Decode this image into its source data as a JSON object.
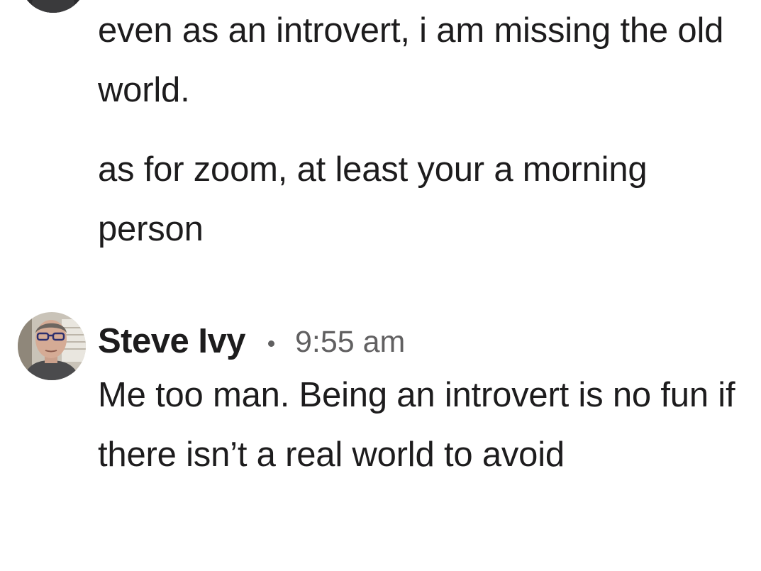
{
  "messages": [
    {
      "paragraphs": [
        "even as an introvert, i am missing the old world.",
        "as for zoom, at least your a morning person"
      ]
    },
    {
      "author": "Steve Ivy",
      "time": "9:55 am",
      "paragraphs": [
        "Me too man. Being an introvert is no fun if there isn’t a real world to avoid"
      ]
    }
  ]
}
